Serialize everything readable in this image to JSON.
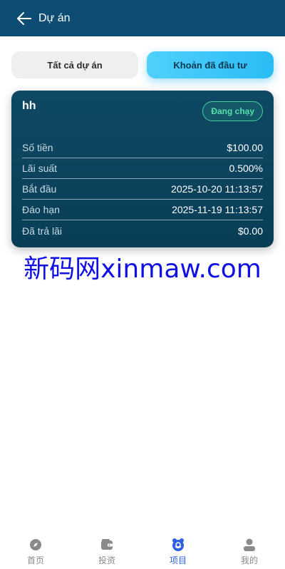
{
  "header": {
    "title": "Dự án"
  },
  "tabs": [
    {
      "label": "Tất cả dự án",
      "active": false
    },
    {
      "label": "Khoản đã đầu tư",
      "active": true
    }
  ],
  "card": {
    "name": "hh",
    "status": "Đang chạy",
    "rows": [
      {
        "label": "Số tiền",
        "value": "$100.00"
      },
      {
        "label": "Lãi suất",
        "value": "0.500%"
      },
      {
        "label": "Bắt đầu",
        "value": "2025-10-20 11:13:57"
      },
      {
        "label": "Đáo hạn",
        "value": "2025-11-19 11:13:57"
      },
      {
        "label": "Đã trả lãi",
        "value": "$0.00"
      }
    ]
  },
  "watermark": "新码网xinmaw.com",
  "nav": [
    {
      "label": "首页",
      "icon": "compass-icon"
    },
    {
      "label": "投资",
      "icon": "wallet-icon"
    },
    {
      "label": "项目",
      "icon": "project-icon",
      "active": true
    },
    {
      "label": "我的",
      "icon": "user-icon"
    }
  ],
  "colors": {
    "header_bg": "#0d4d73",
    "card_bg": "#0f4864",
    "tab_active": "#2bbcf5",
    "status_green": "#55e0a8",
    "nav_active": "#2f5fe3",
    "watermark": "#1010e6"
  }
}
